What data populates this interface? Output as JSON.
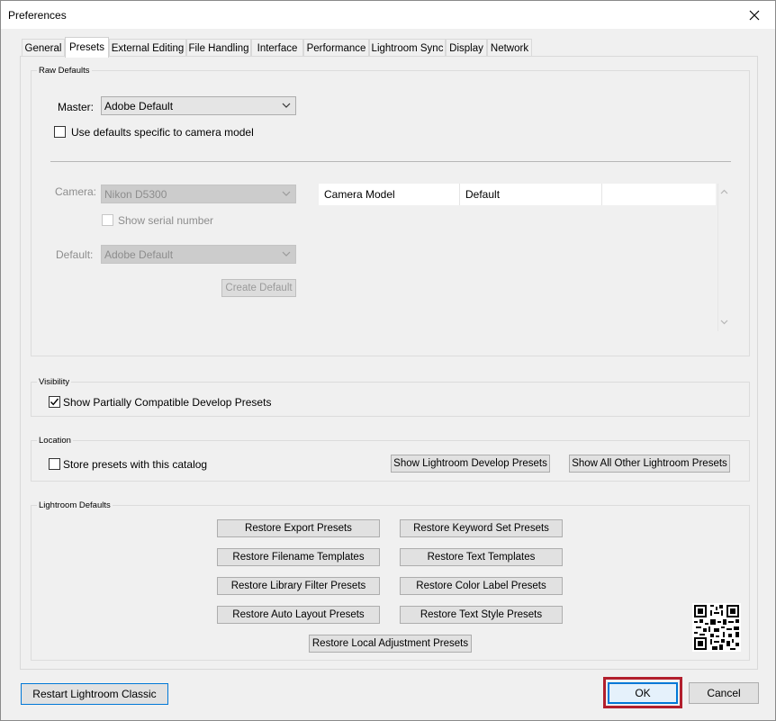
{
  "window": {
    "title": "Preferences"
  },
  "tabs": [
    {
      "label": "General"
    },
    {
      "label": "Presets",
      "active": true
    },
    {
      "label": "External Editing"
    },
    {
      "label": "File Handling"
    },
    {
      "label": "Interface"
    },
    {
      "label": "Performance"
    },
    {
      "label": "Lightroom Sync"
    },
    {
      "label": "Display"
    },
    {
      "label": "Network"
    }
  ],
  "raw_defaults": {
    "group_label": "Raw Defaults",
    "master_label": "Master:",
    "master_value": "Adobe Default",
    "camera_specific_label": "Use defaults specific to camera model",
    "camera_specific_checked": false,
    "camera_label": "Camera:",
    "camera_value": "Nikon D5300",
    "show_serial_label": "Show serial number",
    "default_label": "Default:",
    "default_value": "Adobe Default",
    "create_default_label": "Create Default",
    "table_headers": [
      "Camera Model",
      "Default",
      ""
    ]
  },
  "visibility": {
    "group_label": "Visibility",
    "show_partial_label": "Show Partially Compatible Develop Presets",
    "show_partial_checked": true
  },
  "location": {
    "group_label": "Location",
    "store_catalog_label": "Store presets with this catalog",
    "store_catalog_checked": false,
    "show_develop_label": "Show Lightroom Develop Presets",
    "show_other_label": "Show All Other Lightroom Presets"
  },
  "lightroom_defaults": {
    "group_label": "Lightroom Defaults",
    "buttons": [
      "Restore Export Presets",
      "Restore Keyword Set Presets",
      "Restore Filename Templates",
      "Restore Text Templates",
      "Restore Library Filter Presets",
      "Restore Color Label Presets",
      "Restore Auto Layout Presets",
      "Restore Text Style Presets",
      "Restore Local Adjustment Presets"
    ]
  },
  "footer": {
    "restart_label": "Restart Lightroom Classic",
    "ok_label": "OK",
    "cancel_label": "Cancel"
  },
  "colors": {
    "accent": "#0078d7",
    "highlight_frame": "#b21f2d",
    "dialog_bg": "#f0f0f0"
  },
  "icons": [
    "close-icon",
    "chevron-down-icon",
    "checkmark-icon",
    "scroll-up-icon",
    "scroll-down-icon",
    "qr-code-icon"
  ]
}
